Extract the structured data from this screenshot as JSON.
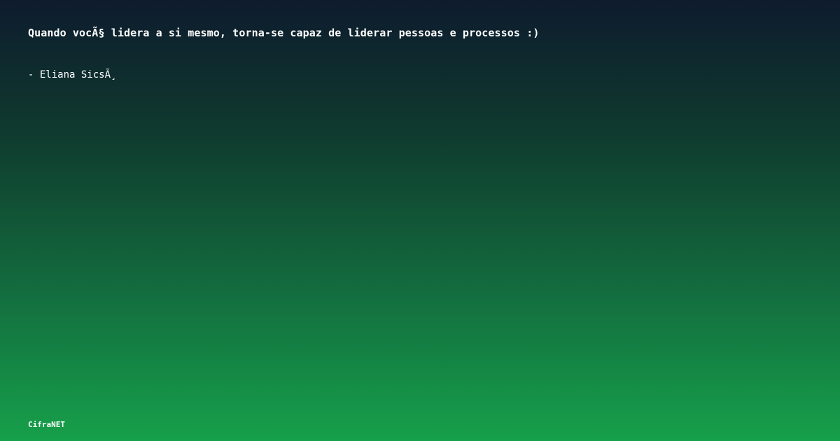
{
  "card": {
    "quote": "Quando vocÃ§ lidera a si mesmo, torna-se capaz de liderar pessoas e processos :)",
    "author": "- Eliana SicsÃ¸",
    "brand": "CifraNET"
  }
}
